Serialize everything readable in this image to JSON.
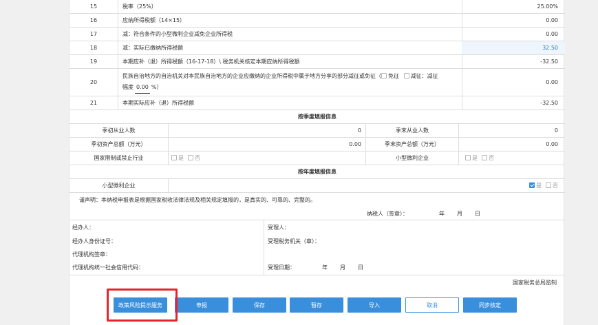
{
  "rows": [
    {
      "num": "15",
      "desc": "税率（25%）",
      "value": "25.00%"
    },
    {
      "num": "16",
      "desc": "应纳所得税额（14×15）",
      "value": "0.00"
    },
    {
      "num": "17",
      "desc": "减：符合条件的小型微利企业减免企业所得税",
      "value": "0.00"
    },
    {
      "num": "18",
      "desc": "减：实际已缴纳所得税额",
      "value": "32.50"
    },
    {
      "num": "19",
      "desc": "本期应补（退）所得税额（16-17-18）\\ 税务机关核定本期应纳所得税额",
      "value": "-32.50"
    },
    {
      "num": "20",
      "desc_line1": "民族自治地方的自治机关对本民族自治地方的企业应缴纳的企业所得税中属于地方分享的部分减征或免征（",
      "exempt_label": "免征",
      "reduce_label": "减征：减征",
      "desc_line2_prefix": "幅度",
      "rate": "0.00",
      "rate_unit": "%）",
      "value": "0.00"
    },
    {
      "num": "21",
      "desc": "本期实际应补（退）所得税额",
      "value": "-32.50"
    }
  ],
  "quarter_section": {
    "title": "按季度填报信息",
    "start_employees_label": "季初从业人数",
    "start_employees_value": "0",
    "end_employees_label": "季末从业人数",
    "end_employees_value": "0",
    "start_assets_label": "季初资产总额（万元）",
    "start_assets_value": "0.00",
    "end_assets_label": "季末资产总额（万元）",
    "end_assets_value": "0.00",
    "restricted_label": "国家限制或禁止行业",
    "small_micro_label": "小型微利企业",
    "yes": "是",
    "no": "否"
  },
  "year_section": {
    "title": "按年度填报信息",
    "small_micro_label": "小型微利企业",
    "yes": "是",
    "no": "否",
    "yes_checked": true
  },
  "declaration": "谨声明：本纳税申报表是根据国家税收法律法规及相关规定填报的，是真实的、可靠的、完整的。",
  "taxpayer_sign": "纳税人（签章）：",
  "date_y": "年",
  "date_m": "月",
  "date_d": "日",
  "agent": {
    "handler": "经办人：",
    "handler_id": "经办人身份证号：",
    "agency_seal": "代理机构签章：",
    "agency_code": "代理机构统一社会信用代码："
  },
  "receiver": {
    "receiver": "受理人：",
    "tax_office": "受理税务机关（章）：",
    "date_label": "受理日期："
  },
  "footer_note": "国家税务总局监制",
  "buttons": {
    "policy": "政策风险提示服务",
    "declare": "申报",
    "save": "保存",
    "temp_save": "暂存",
    "import": "导入",
    "cancel": "取消",
    "sync": "同步核定"
  },
  "colors": {
    "accent": "#3a8fdc",
    "highlight_box": "#e8232b"
  }
}
